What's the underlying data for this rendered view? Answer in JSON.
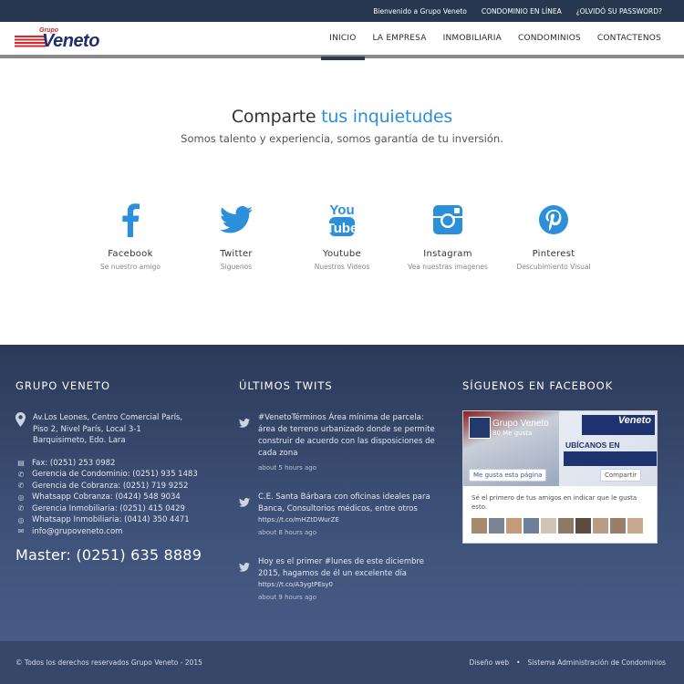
{
  "topbar": {
    "welcome": "Bienvenido a Grupo Veneto",
    "condominio": "CONDOMINIO EN LÍNEA",
    "forgot": "¿OLVIDÓ SU PASSWORD?"
  },
  "logo": {
    "small": "Grupo",
    "big": "Veneto"
  },
  "nav": {
    "items": [
      {
        "label": "INICIO",
        "active": true
      },
      {
        "label": "LA EMPRESA"
      },
      {
        "label": "INMOBILIARIA"
      },
      {
        "label": "CONDOMINIOS"
      },
      {
        "label": "CONTACTENOS"
      }
    ]
  },
  "hero": {
    "title_main": "Comparte ",
    "title_accent": "tus inquietudes",
    "subtitle": "Somos talento y experiencia, somos garantía de tu inversión.",
    "accent_color": "#2b90d9"
  },
  "socials": [
    {
      "name": "Facebook",
      "desc": "Se nuestro amigo",
      "icon": "facebook-icon"
    },
    {
      "name": "Twitter",
      "desc": "Siguenos",
      "icon": "twitter-icon"
    },
    {
      "name": "Youtube",
      "desc": "Nuestros Videos",
      "icon": "youtube-icon"
    },
    {
      "name": "Instagram",
      "desc": "Vea nuestras imagenes",
      "icon": "instagram-icon"
    },
    {
      "name": "Pinterest",
      "desc": "Descubimiento Visual",
      "icon": "pinterest-icon"
    }
  ],
  "footer": {
    "col1": {
      "title": "GRUPO VENETO",
      "address": [
        "Av.Los Leones, Centro Comercial París,",
        "Piso 2, Nivel París, Local 3-1",
        "Barquisimeto, Edo. Lara"
      ],
      "contacts": [
        {
          "icon": "printer-icon",
          "text": "Fax: (0251) 253 0982"
        },
        {
          "icon": "phone-icon",
          "text": "Gerencia de Condominio: (0251) 935 1483"
        },
        {
          "icon": "phone-icon",
          "text": "Gerencia de Cobranza: (0251) 719 9252"
        },
        {
          "icon": "whatsapp-icon",
          "text": "Whatsapp Cobranza: (0424) 548 9034"
        },
        {
          "icon": "phone-icon",
          "text": "Gerencia Inmobiliaria: (0251) 415 0429"
        },
        {
          "icon": "whatsapp-icon",
          "text": "Whatsapp Inmobiliaria: (0414) 350 4471"
        },
        {
          "icon": "envelope-icon",
          "text": "info@grupoveneto.com"
        }
      ],
      "master": "Master: (0251) 635 8889"
    },
    "col2": {
      "title": "ÚLTIMOS TWITS",
      "tweets": [
        {
          "text": "#VenetoTérminos Área mínima de parcela: área de terreno urbanizado donde se permite construir de acuerdo con las disposiciones de cada zona",
          "link": "",
          "time": "about 5 hours ago"
        },
        {
          "text": "C.E. Santa Bárbara con oficinas ideales para Banca, Consultorios médicos, entre otros",
          "link": "https://t.co/mHZtDWurZE",
          "time": "about 8 hours ago"
        },
        {
          "text": "Hoy es el primer #lunes de este diciembre 2015, hagamos de él un excelente día",
          "link": "https://t.co/A3ygtPEsy0",
          "time": "about 9 hours ago"
        }
      ]
    },
    "col3": {
      "title": "SÍGUENOS EN FACEBOOK",
      "page_name": "Grupo Veneto",
      "likes": "80 Me gusta",
      "logo_text": "Veneto",
      "ubicanos": "UBÍCANOS EN",
      "like_btn": "Me gusta esta página",
      "share_btn": "Compartir",
      "friends_text": "Sé el primero de tus amigos en indicar que le gusta esto."
    }
  },
  "bottombar": {
    "copyright": "© Todos los derechos reservados Grupo Veneto - 2015",
    "link1": "Diseño web",
    "sep": "•",
    "link2": "Sistema Administración de Condominios"
  }
}
